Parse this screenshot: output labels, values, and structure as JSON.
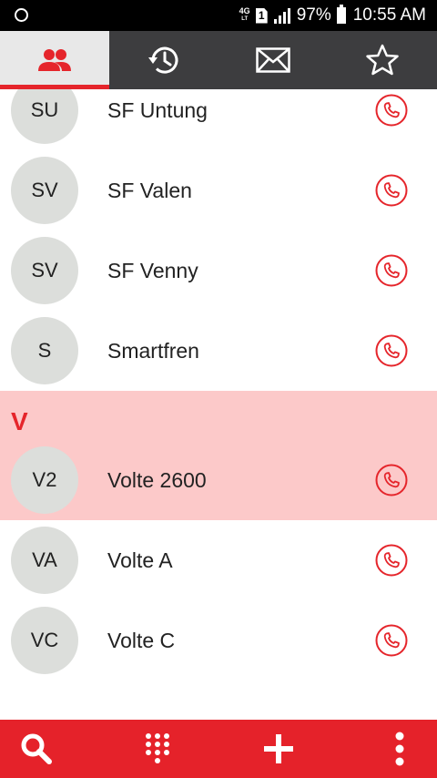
{
  "status_bar": {
    "network": "4G",
    "sim": "1",
    "battery_percent": "97%",
    "time": "10:55 AM"
  },
  "tabs": [
    {
      "icon": "contacts-icon",
      "active": true
    },
    {
      "icon": "history-icon",
      "active": false
    },
    {
      "icon": "message-icon",
      "active": false
    },
    {
      "icon": "star-icon",
      "active": false
    }
  ],
  "contacts_top": [
    {
      "initials": "SU",
      "name": "SF Untung"
    },
    {
      "initials": "SV",
      "name": "SF Valen"
    },
    {
      "initials": "SV",
      "name": "SF Venny"
    },
    {
      "initials": "S",
      "name": "Smartfren"
    }
  ],
  "section": {
    "letter": "V"
  },
  "contacts_v": [
    {
      "initials": "V2",
      "name": "Volte 2600",
      "highlighted": true
    },
    {
      "initials": "VA",
      "name": "Volte A"
    },
    {
      "initials": "VC",
      "name": "Volte C"
    }
  ],
  "bottom_bar": [
    "search-icon",
    "dialpad-icon",
    "add-icon",
    "more-icon"
  ],
  "colors": {
    "accent": "#e5222a",
    "highlight": "#fcc9c9",
    "avatar": "#dcdedb",
    "tabbar": "#3d3d3f"
  }
}
